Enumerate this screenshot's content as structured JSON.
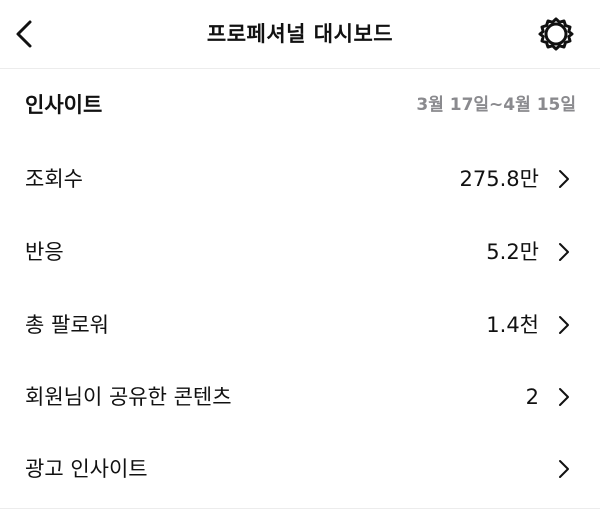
{
  "header": {
    "title": "프로페셔널 대시보드",
    "back_icon": "chevron-left-icon",
    "settings_icon": "gear-icon"
  },
  "insights": {
    "title": "인사이트",
    "date_range": "3월 17일~4월 15일",
    "date_color": "#8a8a8e"
  },
  "rows": [
    {
      "label": "조회수",
      "value": "275.8만"
    },
    {
      "label": "반응",
      "value": "5.2만"
    },
    {
      "label": "총 팔로워",
      "value": "1.4천"
    },
    {
      "label": "회원님이 공유한 콘텐츠",
      "value": "2"
    },
    {
      "label": "광고 인사이트",
      "value": ""
    }
  ]
}
